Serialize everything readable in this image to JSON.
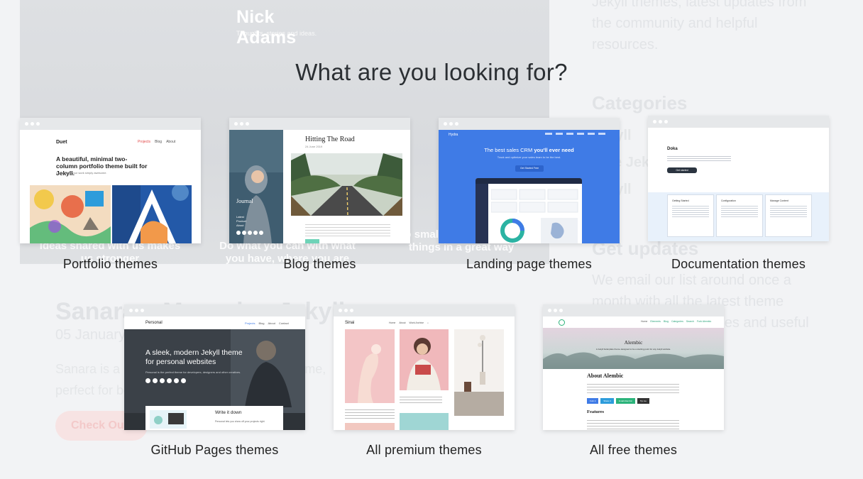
{
  "background": {
    "site_title": "Nick Adams",
    "site_subtitle": "Thoughts, stories and ideas.",
    "left_caption_1": "Ideas shared with us makes us stronger",
    "left_caption_2": "Do what you can with what you have, where you are",
    "left_caption_3": "Do small things, do small things in a great way",
    "right_intro": "Jekyll themes, latest updates from the community and helpful resources.",
    "categories_heading": "Categories",
    "category_items": [
      "Jekyll",
      "Free Jekyll",
      "Jekyll"
    ],
    "updates_heading": "Get updates",
    "updates_text": "We email our list around once a month with all the latest theme releases, sales, articles and useful resources.",
    "post_title": "Sanara – Magazine Jekyll",
    "post_date": "05 January",
    "post_excerpt": "Sanara is a modern and fully responsive theme, perfect for both",
    "cta_label": "Check Out"
  },
  "modal": {
    "title": "What are you looking for?",
    "cards": [
      {
        "label": "Portfolio themes"
      },
      {
        "label": "Blog themes"
      },
      {
        "label": "Landing page themes"
      },
      {
        "label": "Documentation themes"
      },
      {
        "label": "GitHub Pages themes"
      },
      {
        "label": "All premium themes"
      },
      {
        "label": "All free themes"
      }
    ]
  },
  "previews": {
    "duet": {
      "brand": "Duet",
      "nav": [
        "Projects",
        "Blog",
        "About"
      ],
      "headline": "A beautiful, minimal two-column portfolio theme built for Jekyll.",
      "sub": "Duet makes your work simply awesome."
    },
    "blog": {
      "heading": "Hitting The Road",
      "date": "24 June 2019",
      "side_title": "Journal",
      "side_links": [
        "Latest",
        "Product",
        "About"
      ]
    },
    "landing": {
      "brand": "Hydra",
      "headline_a": "The best sales CRM ",
      "headline_b": "you'll ever need",
      "sub": "Track and optimize your sales team to be the best.",
      "button": "Get Started Free"
    },
    "docs": {
      "brand": "Doka",
      "button": "Get started",
      "cols": [
        "Getting Started",
        "Configuration",
        "Manage Content"
      ]
    },
    "personal": {
      "brand": "Personal",
      "nav": [
        "Projects",
        "Blog",
        "About",
        "Contact"
      ],
      "headline": "A sleek, modern Jekyll theme for personal websites",
      "sub": "Personal is the perfect theme for developers, designers and other creatives.",
      "card_title": "Write it down",
      "card_sub": "Personal lets you show off your projects right"
    },
    "sinai": {
      "brand": "Sinai",
      "nav": [
        "Home",
        "About",
        "Work Archive"
      ]
    },
    "alembic": {
      "nav": [
        "Home",
        "Elements",
        "Blog",
        "Categories",
        "Search",
        "Fork Alembic"
      ],
      "hero_title": "Alembic",
      "hero_sub": "A Jekyll boilerplate theme designed to be a starting point for any Jekyll website.",
      "about_heading": "About Alembic",
      "features_heading": "Features",
      "buttons": [
        "Fork it",
        "Share it",
        "Install Alembic",
        "Tip me"
      ]
    }
  },
  "colors": {
    "landing_blue": "#3f7be6",
    "personal_dark": "#3b4148",
    "docs_light": "#e8f1fb"
  }
}
